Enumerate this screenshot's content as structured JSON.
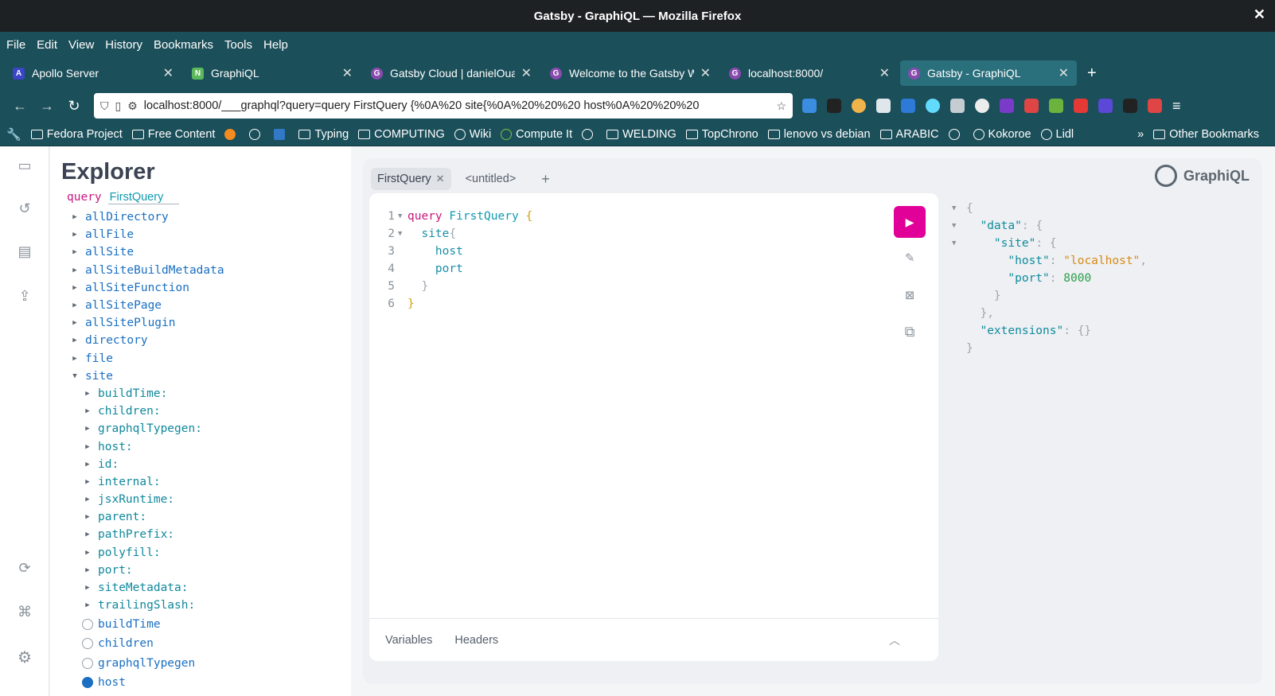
{
  "window": {
    "title": "Gatsby - GraphiQL — Mozilla Firefox"
  },
  "menu": [
    "File",
    "Edit",
    "View",
    "History",
    "Bookmarks",
    "Tools",
    "Help"
  ],
  "tabs": [
    {
      "label": "Apollo Server",
      "color": "#3a46c7",
      "glyph": "A"
    },
    {
      "label": "GraphiQL",
      "color": "#5cb85c",
      "glyph": "N"
    },
    {
      "label": "Gatsby Cloud | danielOuar",
      "color": "#8a4baf",
      "glyph": "G"
    },
    {
      "label": "Welcome to the Gatsby W",
      "color": "#8a4baf",
      "glyph": "G"
    },
    {
      "label": "localhost:8000/",
      "color": "#8a4baf",
      "glyph": "G"
    },
    {
      "label": "Gatsby - GraphiQL",
      "color": "#8a4baf",
      "glyph": "G"
    }
  ],
  "url": "localhost:8000/___graphql?query=query FirstQuery {%0A%20 site{%0A%20%20%20 host%0A%20%20%20",
  "bookmarks": [
    "Fedora Project",
    "Free Content",
    "Typing",
    "COMPUTING",
    "Wiki",
    "Compute It",
    "WELDING",
    "TopChrono",
    "lenovo vs debian",
    "ARABIC",
    "Kokoroe",
    "Lidl",
    "Other Bookmarks"
  ],
  "explorer": {
    "title": "Explorer",
    "query_kw": "query",
    "query_name": "FirstQuery",
    "roots": [
      "allDirectory",
      "allFile",
      "allSite",
      "allSiteBuildMetadata",
      "allSiteFunction",
      "allSitePage",
      "allSitePlugin",
      "directory",
      "file",
      "site"
    ],
    "site_args": [
      "buildTime:",
      "children:",
      "graphqlTypegen:",
      "host:",
      "id:",
      "internal:",
      "jsxRuntime:",
      "parent:",
      "pathPrefix:",
      "polyfill:",
      "port:",
      "siteMetadata:",
      "trailingSlash:"
    ],
    "site_fields": [
      "buildTime",
      "children",
      "graphqlTypegen",
      "host"
    ]
  },
  "editor": {
    "tab_active": "FirstQuery",
    "tab_other": "<untitled>",
    "logo": "GraphiQL",
    "lines": [
      "1",
      "2",
      "3",
      "4",
      "5",
      "6"
    ],
    "code": {
      "query": "query",
      "name": "FirstQuery",
      "site": "site",
      "host": "host",
      "port": "port"
    },
    "bottom_tabs": [
      "Variables",
      "Headers"
    ]
  },
  "result": {
    "data_key": "\"data\"",
    "site_key": "\"site\"",
    "host_key": "\"host\"",
    "host_val": "\"localhost\"",
    "port_key": "\"port\"",
    "port_val": "8000",
    "ext_key": "\"extensions\""
  },
  "colors": {
    "accent": "#e10098",
    "chrome": "#1b4f5a"
  }
}
